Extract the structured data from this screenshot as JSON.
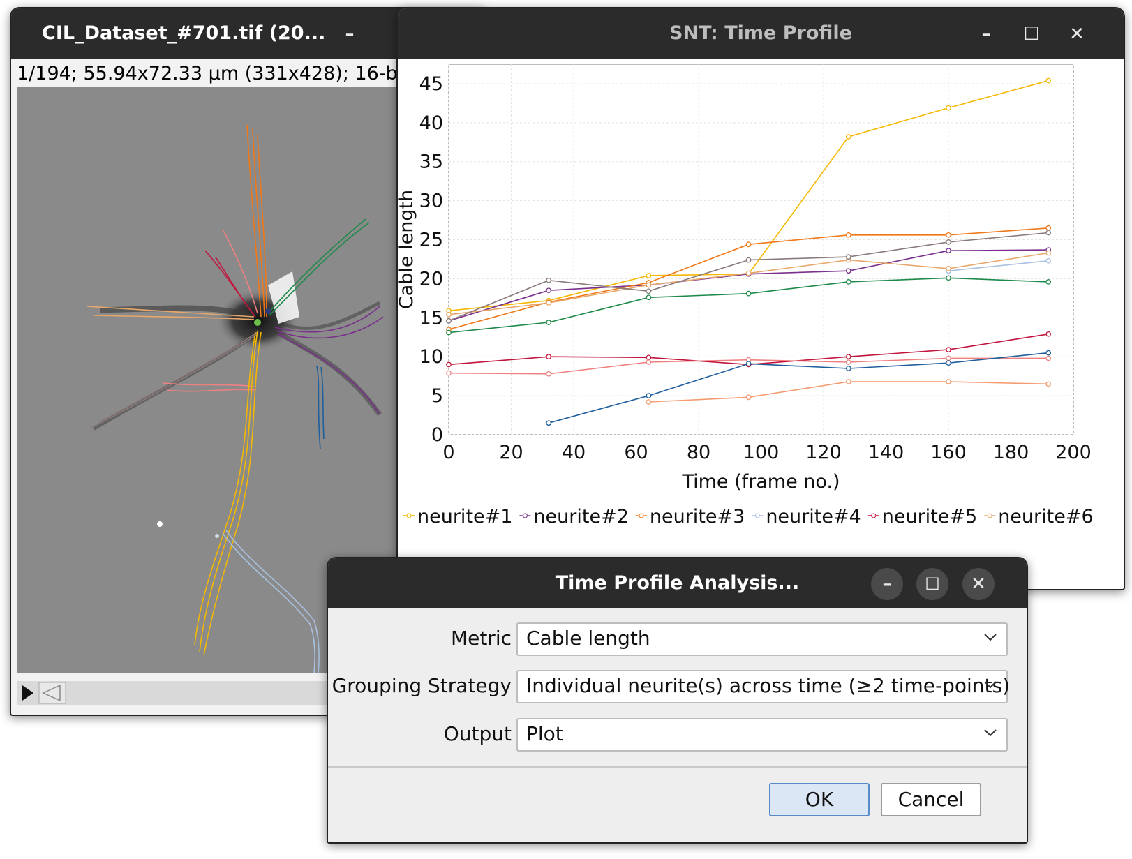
{
  "image_window": {
    "title": "CIL_Dataset_#701.tif (20...",
    "info": "1/194; 55.94x72.33 µm (331x428); 16-bi",
    "minimize": "–"
  },
  "plot_window": {
    "title": "SNT: Time Profile",
    "minimize": "–",
    "maximize": "☐",
    "close": "✕"
  },
  "chart_data": {
    "type": "line",
    "title": "",
    "xlabel": "Time (frame no.)",
    "ylabel": "Cable length",
    "xlim": [
      0,
      200
    ],
    "ylim": [
      0,
      47.5
    ],
    "xticks": [
      0,
      20,
      40,
      60,
      80,
      100,
      120,
      140,
      160,
      180,
      200
    ],
    "yticks": [
      0,
      5,
      10,
      15,
      20,
      25,
      30,
      35,
      40,
      45
    ],
    "grid": true,
    "legend_position": "bottom",
    "series": [
      {
        "name": "neurite#1",
        "color": "#f5b800",
        "x": [
          0,
          32,
          64,
          96,
          128,
          160,
          192
        ],
        "y": [
          15.9,
          17.2,
          20.4,
          20.6,
          38.2,
          41.9,
          45.4
        ]
      },
      {
        "name": "neurite#2",
        "color": "#7a2f8c",
        "x": [
          0,
          32,
          64,
          96,
          128,
          160,
          192
        ],
        "y": [
          14.6,
          18.5,
          19.2,
          20.6,
          21.0,
          23.6,
          23.7
        ]
      },
      {
        "name": "neurite#3",
        "color": "#f07818",
        "x": [
          0,
          32,
          64,
          96,
          128,
          160,
          192
        ],
        "y": [
          13.5,
          17.0,
          19.5,
          24.4,
          25.6,
          25.6,
          26.5
        ]
      },
      {
        "name": "neurite#4",
        "color": "#a9c1e0",
        "x": [
          160,
          192
        ],
        "y": [
          21.0,
          22.3
        ]
      },
      {
        "name": "neurite#5",
        "color": "#c2143c",
        "x": [
          0,
          32,
          64,
          96,
          128,
          160,
          192
        ],
        "y": [
          9.0,
          10.0,
          9.9,
          9.0,
          10.0,
          10.9,
          12.9
        ]
      },
      {
        "name": "neurite#6",
        "color": "#e8a76a",
        "x": [
          0,
          32,
          64,
          96,
          128,
          160,
          192
        ],
        "y": [
          15.4,
          16.9,
          19.2,
          20.7,
          22.4,
          21.3,
          23.3
        ]
      },
      {
        "name": "",
        "color": "#8a7a7a",
        "x": [
          0,
          32,
          64,
          96,
          128,
          160,
          192
        ],
        "y": [
          14.6,
          19.8,
          18.4,
          22.4,
          22.8,
          24.7,
          25.9
        ]
      },
      {
        "name": "",
        "color": "#1e8a4a",
        "x": [
          0,
          32,
          64,
          96,
          128,
          160,
          192
        ],
        "y": [
          13.1,
          14.4,
          17.6,
          18.1,
          19.6,
          20.1,
          19.6
        ]
      },
      {
        "name": "",
        "color": "#f08080",
        "x": [
          0,
          32,
          64,
          96,
          128,
          160,
          192
        ],
        "y": [
          7.9,
          7.8,
          9.3,
          9.6,
          9.3,
          9.8,
          9.8
        ]
      },
      {
        "name": "",
        "color": "#1f5f9c",
        "x": [
          32,
          64,
          96,
          128,
          160,
          192
        ],
        "y": [
          1.5,
          5.0,
          9.1,
          8.5,
          9.2,
          10.5
        ]
      },
      {
        "name": "",
        "color": "#f59a6f",
        "x": [
          64,
          96,
          128,
          160,
          192
        ],
        "y": [
          4.2,
          4.8,
          6.8,
          6.8,
          6.5
        ]
      }
    ]
  },
  "dialog": {
    "title": "Time Profile Analysis...",
    "minimize": "–",
    "maximize": "☐",
    "close": "✕",
    "fields": {
      "metric_label": "Metric",
      "metric_value": "Cable length",
      "grouping_label": "Grouping Strategy",
      "grouping_value": "Individual neurite(s) across time (≥2 time-points)",
      "output_label": "Output",
      "output_value": "Plot"
    },
    "ok_label": "OK",
    "cancel_label": "Cancel",
    "ok_bg": "#dbe7f5",
    "ok_border": "#5a8bc8"
  }
}
